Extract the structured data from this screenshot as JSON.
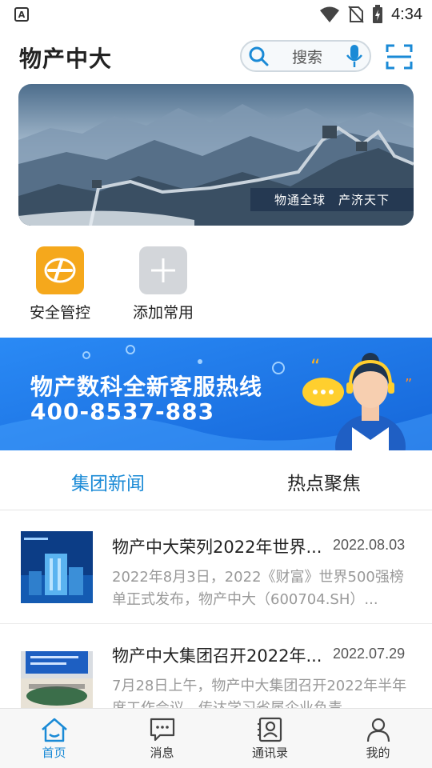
{
  "status_bar": {
    "app_badge": "A",
    "time": "4:34"
  },
  "header": {
    "title": "物产中大",
    "search_placeholder": "搜索"
  },
  "banner": {
    "caption": "物通全球　产济天下"
  },
  "quick_actions": [
    {
      "label": "安全管控",
      "icon": "safety-control-icon",
      "color": "#f5a81c"
    },
    {
      "label": "添加常用",
      "icon": "add-icon",
      "color": "#d3d6da"
    }
  ],
  "hotline": {
    "title": "物产数科全新客服热线",
    "number": "400-8537-883"
  },
  "tabs": [
    {
      "label": "集团新闻",
      "active": true
    },
    {
      "label": "热点聚焦",
      "active": false
    }
  ],
  "news": [
    {
      "title": "物产中大荣列2022年世界...",
      "date": "2022.08.03",
      "summary": "2022年8月3日，2022《财富》世界500强榜单正式发布，物产中大（600704.SH）..."
    },
    {
      "title": "物产中大集团召开2022年...",
      "date": "2022.07.29",
      "summary": "7月28日上午，物产中大集团召开2022年半年度工作会议，传达学习省属企业负责"
    }
  ],
  "bottom_nav": [
    {
      "label": "首页",
      "icon": "home-icon",
      "active": true
    },
    {
      "label": "消息",
      "icon": "message-icon",
      "active": false
    },
    {
      "label": "通讯录",
      "icon": "contacts-icon",
      "active": false
    },
    {
      "label": "我的",
      "icon": "profile-icon",
      "active": false
    }
  ],
  "colors": {
    "accent": "#1a8ad6",
    "hotline_bg": "#1b7cf0",
    "safety_icon": "#f5a81c"
  }
}
